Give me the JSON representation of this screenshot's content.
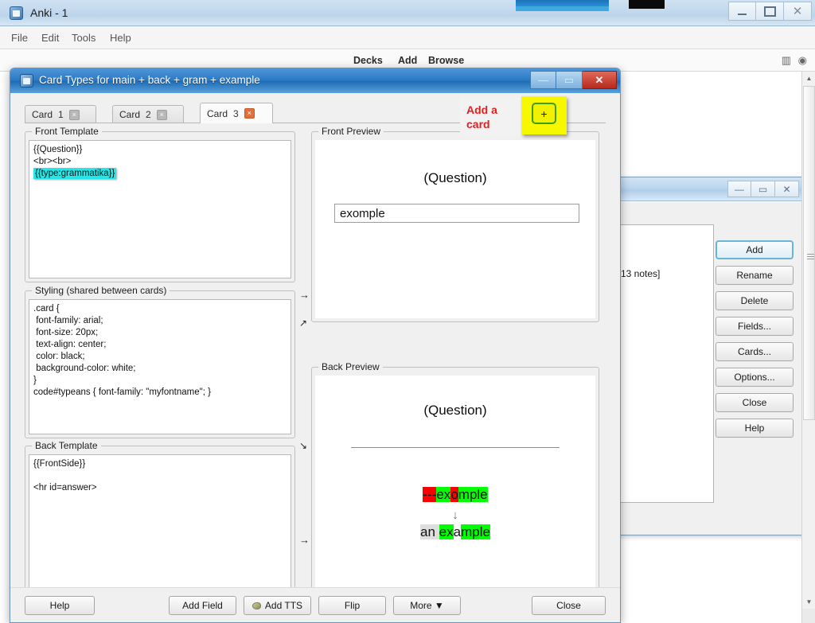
{
  "main_window": {
    "title": "Anki - 1",
    "icon": "anki-logo-icon",
    "menu": [
      "File",
      "Edit",
      "Tools",
      "Help"
    ],
    "nav": [
      "Decks",
      "Add",
      "Browse"
    ],
    "nav_icons": [
      "stats-icon",
      "sync-icon"
    ],
    "controls": {
      "minimize": "minimize-icon",
      "maximize": "maximize-icon",
      "close": "close-icon"
    }
  },
  "bg_window": {
    "list_text": "13 notes]",
    "buttons": [
      "Add",
      "Rename",
      "Delete",
      "Fields...",
      "Cards...",
      "Options...",
      "Close",
      "Help"
    ],
    "controls": {
      "minimize": "minimize-icon",
      "maximize": "maximize-icon",
      "close": "close-icon"
    }
  },
  "dialog": {
    "title": "Card Types for main + back + gram + example",
    "icon": "anki-logo-icon",
    "controls": {
      "minimize": "minimize-icon",
      "maximize": "maximize-icon",
      "close": "close-icon"
    },
    "tabs": [
      {
        "label": "Card",
        "num": "1",
        "close": "×",
        "active": false
      },
      {
        "label": "Card",
        "num": "2",
        "close": "×",
        "active": false
      },
      {
        "label": "Card",
        "num": "3",
        "close": "×",
        "active": true
      }
    ],
    "front_template": {
      "legend": "Front Template",
      "line1": "{{Question}}",
      "line2": "<br><br>",
      "highlighted": "{{type:grammatika}}"
    },
    "styling": {
      "legend": "Styling (shared between cards)",
      "code": ".card {\n font-family: arial;\n font-size: 20px;\n text-align: center;\n color: black;\n background-color: white;\n}\ncode#typeans { font-family: \"myfontname\"; }"
    },
    "back_template": {
      "legend": "Back Template",
      "code": "{{FrontSide}}\n\n<hr id=answer>"
    },
    "front_preview": {
      "legend": "Front Preview",
      "question": "(Question)",
      "typed_answer": "exomple"
    },
    "back_preview": {
      "legend": "Back Preview",
      "question": "(Question)",
      "diff_typed": [
        {
          "text": "---",
          "state": "bad"
        },
        {
          "text": "ex",
          "state": "good"
        },
        {
          "text": "o",
          "state": "bad"
        },
        {
          "text": "mple",
          "state": "good"
        }
      ],
      "diff_arrow": "↓",
      "diff_correct": [
        {
          "text": "an ",
          "state": "neutral"
        },
        {
          "text": "ex",
          "state": "good"
        },
        {
          "text": "a",
          "state": "plain"
        },
        {
          "text": "mple",
          "state": "good"
        }
      ]
    },
    "bottom_buttons": [
      {
        "label": "Help",
        "icon": ""
      },
      {
        "label": "Add Field",
        "icon": ""
      },
      {
        "label": "Add TTS",
        "icon": "tts-icon"
      },
      {
        "label": "Flip",
        "icon": ""
      },
      {
        "label": "More ▼",
        "icon": ""
      },
      {
        "label": "Close",
        "icon": ""
      }
    ]
  },
  "annotation": {
    "text": "Add a card",
    "button_glyph": "+",
    "text_color": "#e02020",
    "highlight_color": "#f7f700"
  }
}
